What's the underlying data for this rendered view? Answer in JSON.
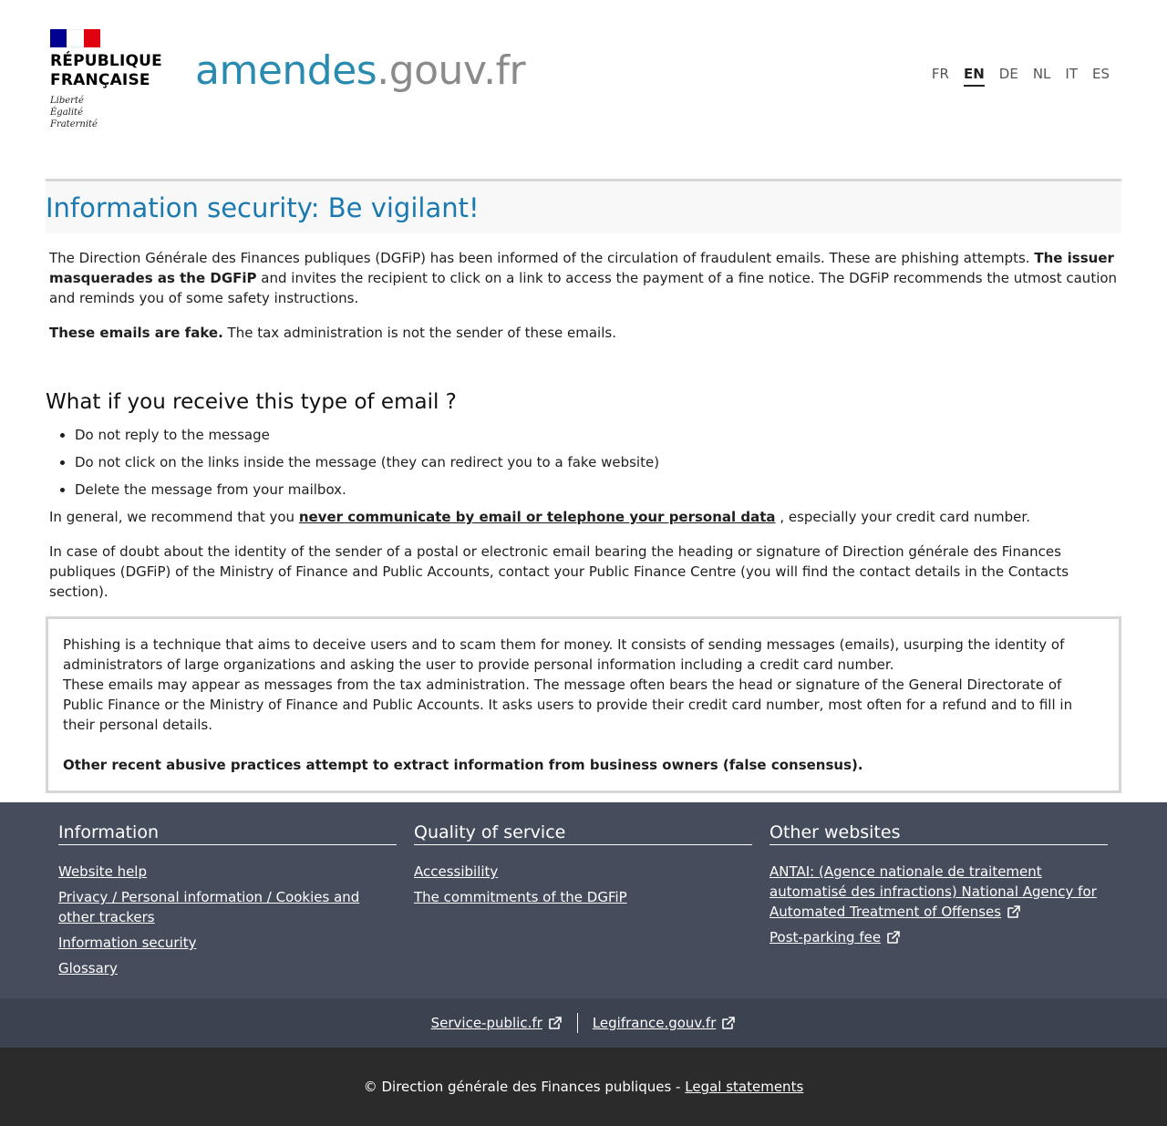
{
  "header": {
    "gov_title_line1": "RÉPUBLIQUE",
    "gov_title_line2": "FRANÇAISE",
    "motto_1": "Liberté",
    "motto_2": "Égalité",
    "motto_3": "Fraternité",
    "site_name_main": "amendes",
    "site_name_domain": ".gouv.fr",
    "flag_colors": [
      "#000091",
      "#ffffff",
      "#e1000f"
    ],
    "languages": [
      "FR",
      "EN",
      "DE",
      "NL",
      "IT",
      "ES"
    ],
    "active_language": "EN"
  },
  "page": {
    "title": "Information security: Be vigilant!",
    "intro_part1": "The Direction Générale des Finances publiques (DGFiP) has been informed of the circulation of fraudulent emails. These are phishing attempts. ",
    "intro_bold": "The issuer masquerades as the DGFiP",
    "intro_part2": " and invites the recipient to click on a link to access the payment of a fine notice. The DGFiP recommends the utmost caution and reminds you of some safety instructions.",
    "fake_bold": "These emails are fake.",
    "fake_text": " The tax administration is not the sender of these emails.",
    "section_heading": "What if you receive this type of email ?",
    "tips": [
      "Do not reply to the message",
      "Do not click on the links inside the message (they can redirect you to a fake website)",
      "Delete the message from your mailbox."
    ],
    "general_prefix": "In general, we recommend that you ",
    "general_link": "never communicate by email or telephone your personal data",
    "general_suffix": " , especially your credit card number.",
    "doubt_text": "In case of doubt about the identity of the sender of a postal or electronic email bearing the heading or signature of Direction générale des Finances publiques (DGFiP) of the Ministry of Finance and Public Accounts, contact your Public Finance Centre (you will find the contact details in the Contacts section).",
    "box_p1": "Phishing is a technique that aims to deceive users and to scam them for money. It consists of sending messages (emails), usurping the identity of administrators of large organizations and asking the user to provide personal information including a credit card number.",
    "box_p2": "These emails may appear as messages from the tax administration. The message often bears the head or signature of the General Directorate of Public Finance or the Ministry of Finance and Public Accounts. It asks users to provide their credit card number, most often for a refund and to fill in their personal details.",
    "box_bold": "Other recent abusive practices attempt to extract information from business owners (false consensus)."
  },
  "footer": {
    "col_information": {
      "title": "Information",
      "links": [
        "Website help",
        "Privacy / Personal information / Cookies and other trackers",
        "Information security",
        "Glossary"
      ]
    },
    "col_quality": {
      "title": "Quality of service",
      "links": [
        "Accessibility",
        "The commitments of the DGFiP"
      ]
    },
    "col_other": {
      "title": "Other websites",
      "links": [
        "ANTAI: (Agence nationale de traitement automatisé des infractions) National Agency for Automated Treatment of Offenses",
        "Post-parking fee"
      ]
    },
    "mid_links": [
      "Service-public.fr",
      "Legifrance.gouv.fr"
    ],
    "copyright": "© Direction générale des Finances publiques - ",
    "legal_link": "Legal statements",
    "colors": {
      "footer_top": "#454d5c",
      "footer_mid": "#3b4350",
      "footer_bottom": "#2b2b2b",
      "title_blue": "#1a7ab0"
    },
    "icons": {
      "external": "external-link-icon"
    }
  }
}
